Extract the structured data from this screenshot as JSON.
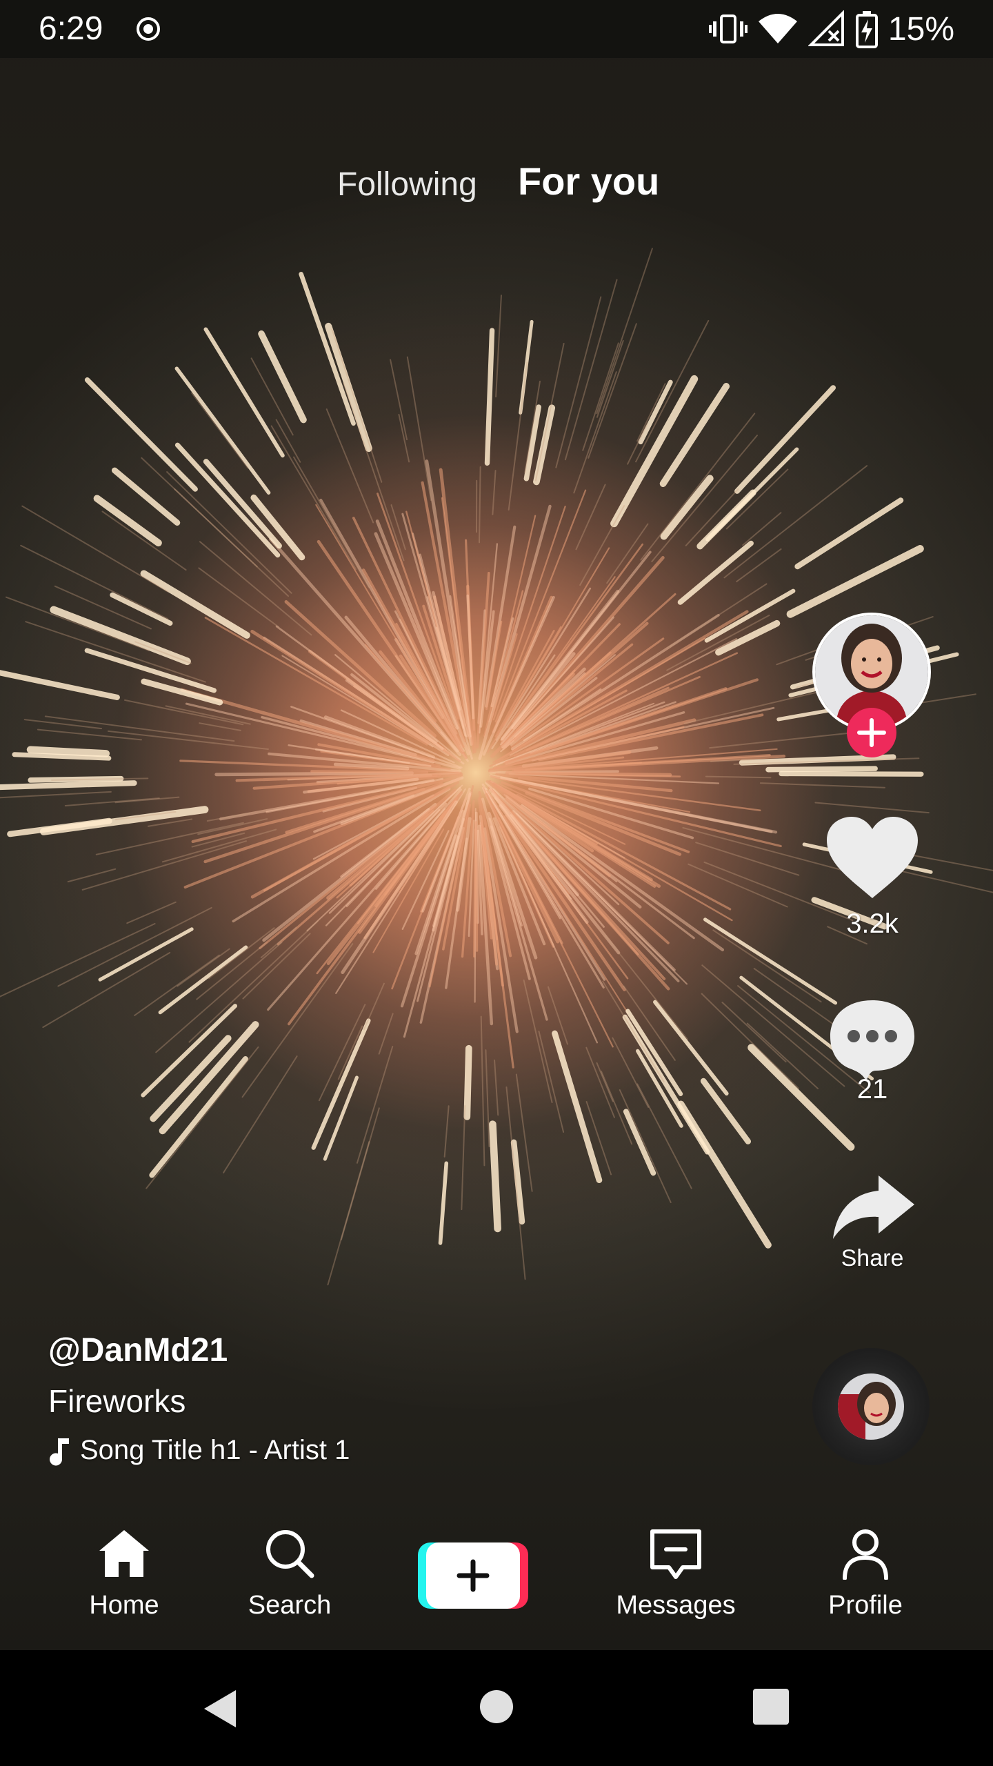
{
  "status_bar": {
    "time": "6:29",
    "battery_percent": "15%"
  },
  "top_tabs": {
    "following": "Following",
    "for_you": "For you"
  },
  "right_rail": {
    "likes_count": "3.2k",
    "comments_count": "21",
    "share_label": "Share"
  },
  "video_info": {
    "username": "@DanMd21",
    "caption": "Fireworks",
    "music": "Song Title h1 - Artist 1"
  },
  "bottom_nav": {
    "home": "Home",
    "search": "Search",
    "messages": "Messages",
    "profile": "Profile"
  },
  "colors": {
    "accent_red": "#ee2a5b",
    "create_cyan": "#25f4ee",
    "create_pink": "#fe2c55"
  }
}
